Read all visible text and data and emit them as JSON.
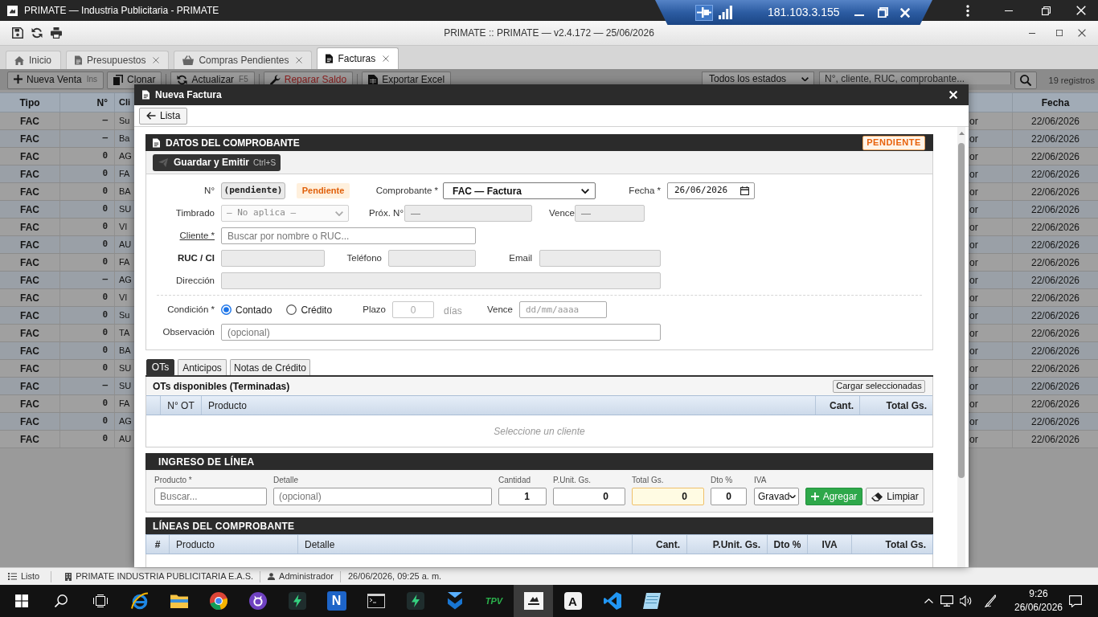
{
  "host_window": {
    "title": "PRIMATE — Industria Publicitaria - PRIMATE"
  },
  "remote_bar": {
    "address": "181.103.3.155",
    "pinned": true
  },
  "app_window": {
    "title": "PRIMATE :: PRIMATE — v2.4.172 — 25/06/2026"
  },
  "tabs": [
    {
      "label": "Inicio",
      "kind": "home",
      "closable": false,
      "selected": false
    },
    {
      "label": "Presupuestos",
      "kind": "document",
      "closable": true,
      "selected": false
    },
    {
      "label": "Compras Pendientes",
      "kind": "basket",
      "closable": true,
      "selected": false
    },
    {
      "label": "Facturas",
      "kind": "document",
      "closable": true,
      "selected": true
    }
  ],
  "toolbar": {
    "buttons": [
      {
        "label": "Nueva Venta",
        "shortcut": "Ins",
        "kind": "plus",
        "color": "#111111",
        "separator_before": false
      },
      {
        "label": "Clonar",
        "kind": "copy",
        "color": "#111111",
        "separator_before": false
      },
      {
        "label": "Actualizar",
        "shortcut": "F5",
        "kind": "refresh",
        "color": "#111111",
        "separator_before": true
      },
      {
        "label": "Reparar Saldo",
        "kind": "wrench",
        "color": "#8a1c1c",
        "separator_before": true
      },
      {
        "label": "Exportar Excel",
        "kind": "sheet",
        "color": "#111111",
        "separator_before": true
      }
    ],
    "status_filter": "Todos los estados",
    "search": {
      "placeholder": "N°, cliente, RUC, comprobante..."
    },
    "record_count": "19 registros"
  },
  "invoice_table": {
    "header": {
      "type": "Tipo",
      "number": "N°",
      "client": "Cli",
      "date": "Fecha"
    },
    "rows": [
      {
        "type": "FAC",
        "number": "—",
        "client": "Su",
        "column_4": "or",
        "date": "22/06/2026"
      },
      {
        "type": "FAC",
        "number": "—",
        "client": "Ba",
        "column_4": "or",
        "date": "22/06/2026"
      },
      {
        "type": "FAC",
        "number": "0",
        "client": "AG",
        "column_4": "or",
        "date": "22/06/2026"
      },
      {
        "type": "FAC",
        "number": "0",
        "client": "FA",
        "column_4": "or",
        "date": "22/06/2026"
      },
      {
        "type": "FAC",
        "number": "0",
        "client": "BA",
        "column_4": "or",
        "date": "22/06/2026"
      },
      {
        "type": "FAC",
        "number": "0",
        "client": "SU",
        "column_4": "or",
        "date": "22/06/2026"
      },
      {
        "type": "FAC",
        "number": "0",
        "client": "VI",
        "column_4": "or",
        "date": "22/06/2026"
      },
      {
        "type": "FAC",
        "number": "0",
        "client": "AU",
        "column_4": "or",
        "date": "22/06/2026"
      },
      {
        "type": "FAC",
        "number": "0",
        "client": "FA",
        "column_4": "or",
        "date": "22/06/2026"
      },
      {
        "type": "FAC",
        "number": "—",
        "client": "AG",
        "column_4": "or",
        "date": "22/06/2026"
      },
      {
        "type": "FAC",
        "number": "0",
        "client": "VI",
        "column_4": "or",
        "date": "22/06/2026"
      },
      {
        "type": "FAC",
        "number": "0",
        "client": "Su",
        "column_4": "or",
        "date": "22/06/2026"
      },
      {
        "type": "FAC",
        "number": "0",
        "client": "TA",
        "column_4": "or",
        "date": "22/06/2026"
      },
      {
        "type": "FAC",
        "number": "0",
        "client": "BA",
        "column_4": "or",
        "date": "22/06/2026"
      },
      {
        "type": "FAC",
        "number": "0",
        "client": "SU",
        "column_4": "or",
        "date": "22/06/2026"
      },
      {
        "type": "FAC",
        "number": "—",
        "client": "SU",
        "column_4": "or",
        "date": "22/06/2026"
      },
      {
        "type": "FAC",
        "number": "0",
        "client": "FA",
        "column_4": "or",
        "date": "22/06/2026"
      },
      {
        "type": "FAC",
        "number": "0",
        "client": "AG",
        "column_4": "or",
        "date": "22/06/2026"
      },
      {
        "type": "FAC",
        "number": "0",
        "client": "AU",
        "column_4": "or",
        "date": "22/06/2026"
      }
    ]
  },
  "modal": {
    "title": "Nueva Factura",
    "back_button": "Lista",
    "header_section": {
      "title": "DATOS DEL COMPROBANTE",
      "status_badge": "PENDIENTE",
      "save_button": {
        "label": "Guardar y Emitir",
        "shortcut": "Ctrl+S"
      }
    },
    "form": {
      "numero": {
        "label": "N°",
        "value": "(pendiente)",
        "state_badge": "Pendiente"
      },
      "comprobante": {
        "label": "Comprobante *",
        "value": "FAC — Factura"
      },
      "fecha": {
        "label": "Fecha *",
        "value": "26/06/2026"
      },
      "timbrado": {
        "label": "Timbrado",
        "value": "— No aplica —",
        "disabled": true
      },
      "proximo_numero": {
        "label": "Próx. N°",
        "value": "—",
        "disabled": true
      },
      "vence_timbrado": {
        "label": "Vence",
        "value": "—",
        "disabled": true
      },
      "cliente": {
        "label": "Cliente *",
        "placeholder": "Buscar por nombre o RUC..."
      },
      "ruc": {
        "label": "RUC / CI",
        "disabled": true
      },
      "telefono": {
        "label": "Teléfono",
        "disabled": true
      },
      "email": {
        "label": "Email",
        "disabled": true
      },
      "direccion": {
        "label": "Dirección",
        "disabled": true
      },
      "condicion": {
        "label": "Condición *",
        "options": [
          {
            "label": "Contado",
            "selected": true
          },
          {
            "label": "Crédito",
            "selected": false
          }
        ]
      },
      "plazo": {
        "label": "Plazo",
        "value": "0",
        "unit": "días",
        "disabled": true
      },
      "vencimiento": {
        "label": "Vence",
        "placeholder": "dd/mm/aaaa"
      },
      "observacion": {
        "label": "Observación",
        "placeholder": "(opcional)"
      }
    },
    "detail_tabs": [
      {
        "label": "OTs",
        "selected": true
      },
      {
        "label": "Anticipos",
        "selected": false
      },
      {
        "label": "Notas de Crédito",
        "selected": false
      }
    ],
    "ots_panel": {
      "title": "OTs disponibles (Terminadas)",
      "load_button": "Cargar seleccionadas",
      "columns": [
        "N° OT",
        "Producto",
        "Cant.",
        "Total Gs."
      ],
      "empty_message": "Seleccione un cliente"
    },
    "line_entry": {
      "title": "INGRESO DE LÍNEA",
      "fields": [
        {
          "label": "Producto *",
          "kind": "input",
          "placeholder": "Buscar...",
          "readonly": false
        },
        {
          "label": "Detalle",
          "kind": "input",
          "placeholder": "(opcional)",
          "readonly": false
        },
        {
          "label": "Cantidad",
          "kind": "input",
          "value": "1",
          "readonly": false
        },
        {
          "label": "P.Unit. Gs.",
          "kind": "input",
          "value": "0",
          "readonly": false
        },
        {
          "label": "Total Gs.",
          "kind": "input",
          "value": "0",
          "readonly": true
        },
        {
          "label": "Dto %",
          "kind": "input",
          "value": "0",
          "readonly": false
        },
        {
          "label": "IVA",
          "kind": "select",
          "value": "Gravad",
          "readonly": false
        }
      ],
      "add_button": "Agregar",
      "clear_button": "Limpiar"
    },
    "lines": {
      "title": "LÍNEAS DEL COMPROBANTE",
      "columns": [
        "#",
        "Producto",
        "Detalle",
        "Cant.",
        "P.Unit. Gs.",
        "Dto %",
        "IVA",
        "Total Gs."
      ]
    }
  },
  "status_bar": {
    "items": [
      {
        "kind": "list",
        "text": "Listo"
      },
      {
        "kind": "building",
        "text": "PRIMATE INDUSTRIA PUBLICITARIA E.A.S."
      },
      {
        "kind": "user",
        "text": "Administrador"
      },
      {
        "kind": "plain",
        "text": "26/06/2026, 09:25 a. m."
      }
    ]
  },
  "taskbar": {
    "apps": [
      {
        "kind": "start",
        "selected": false
      },
      {
        "kind": "search",
        "selected": false
      },
      {
        "kind": "taskview",
        "selected": false
      },
      {
        "kind": "orbit",
        "selected": false
      },
      {
        "kind": "folder",
        "selected": false
      },
      {
        "kind": "wheel",
        "selected": false
      },
      {
        "kind": "ring",
        "selected": false
      },
      {
        "kind": "bolt",
        "selected": false
      },
      {
        "kind": "letter-blue",
        "label": "N",
        "selected": false
      },
      {
        "kind": "terminal",
        "selected": false
      },
      {
        "kind": "bolt",
        "selected": false
      },
      {
        "kind": "chevrons",
        "selected": false
      },
      {
        "kind": "wordmark",
        "label": "TPV",
        "selected": false
      },
      {
        "kind": "logo",
        "selected": true
      },
      {
        "kind": "letter-light",
        "label": "A",
        "selected": false
      },
      {
        "kind": "ribbon",
        "selected": false
      },
      {
        "kind": "notepad",
        "selected": false
      }
    ],
    "clock": {
      "time": "9:26",
      "date": "26/06/2026"
    }
  }
}
